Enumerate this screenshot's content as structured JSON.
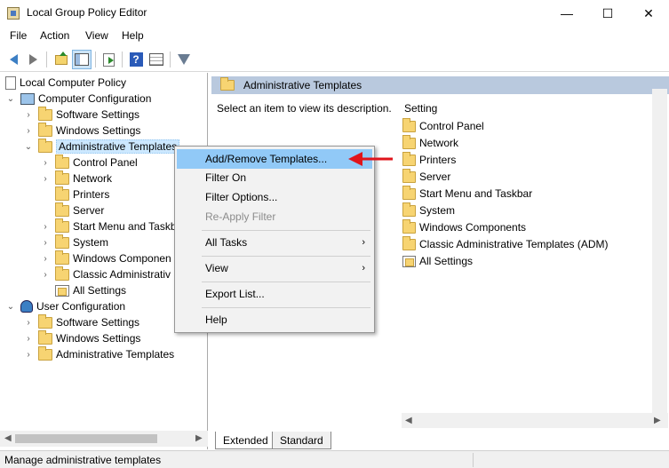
{
  "window": {
    "title": "Local Group Policy Editor",
    "minimize": "—",
    "maximize": "☐",
    "close": "✕"
  },
  "menu": [
    "File",
    "Action",
    "View",
    "Help"
  ],
  "tree": {
    "root": "Local Computer Policy",
    "computer_config": "Computer Configuration",
    "computer_children": [
      "Software Settings",
      "Windows Settings",
      "Administrative Templates"
    ],
    "admin_children": [
      "Control Panel",
      "Network",
      "Printers",
      "Server",
      "Start Menu and Taskb",
      "System",
      "Windows Componen",
      "Classic Administrativ",
      "All Settings"
    ],
    "user_config": "User Configuration",
    "user_children": [
      "Software Settings",
      "Windows Settings",
      "Administrative Templates"
    ]
  },
  "right": {
    "header": "Administrative Templates",
    "description": "Select an item to view its description.",
    "column_header": "Setting",
    "items": [
      "Control Panel",
      "Network",
      "Printers",
      "Server",
      "Start Menu and Taskbar",
      "System",
      "Windows Components",
      "Classic Administrative Templates (ADM)",
      "All Settings"
    ]
  },
  "tabs": [
    "Extended",
    "Standard"
  ],
  "context_menu": {
    "add_remove": "Add/Remove Templates...",
    "filter_on": "Filter On",
    "filter_options": "Filter Options...",
    "reapply": "Re-Apply Filter",
    "all_tasks": "All Tasks",
    "view": "View",
    "export": "Export List...",
    "help": "Help",
    "submenu_arrow": "›"
  },
  "status": "Manage administrative templates",
  "colors": {
    "highlight": "#91c9f7",
    "header_bar": "#b9c9de",
    "red_arrow": "#e0141b",
    "folder": "#f7d472"
  }
}
